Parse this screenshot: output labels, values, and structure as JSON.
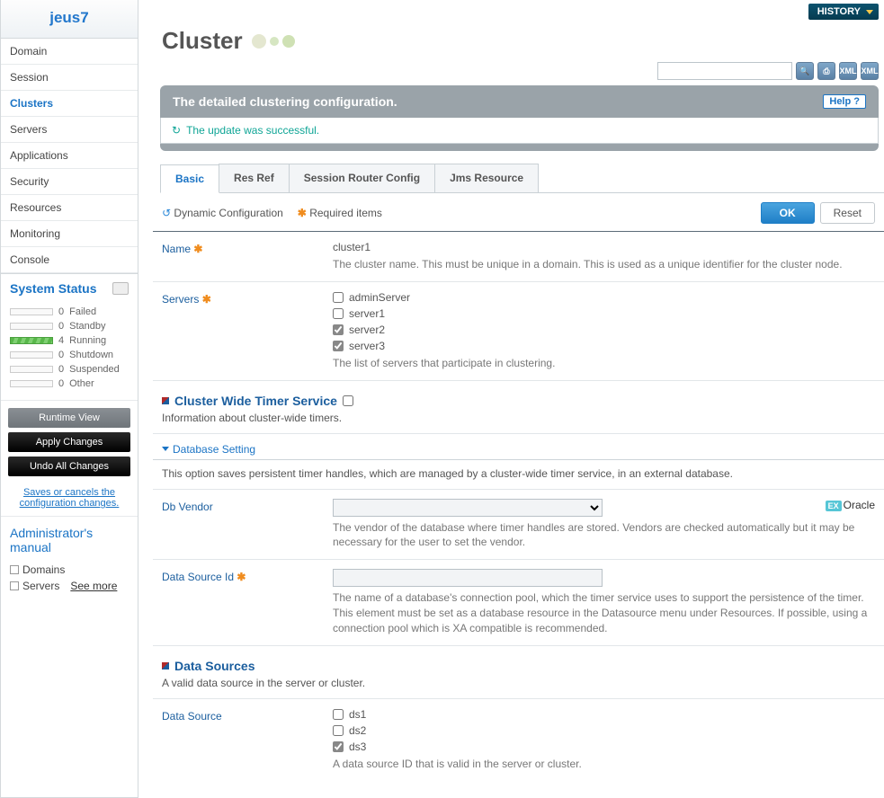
{
  "brand": "jeus7",
  "nav": [
    "Domain",
    "Session",
    "Clusters",
    "Servers",
    "Applications",
    "Security",
    "Resources",
    "Monitoring",
    "Console"
  ],
  "nav_active": 2,
  "system_status": {
    "title": "System Status",
    "rows": [
      {
        "count": "0",
        "label": "Failed",
        "filled": false
      },
      {
        "count": "0",
        "label": "Standby",
        "filled": false
      },
      {
        "count": "4",
        "label": "Running",
        "filled": true
      },
      {
        "count": "0",
        "label": "Shutdown",
        "filled": false
      },
      {
        "count": "0",
        "label": "Suspended",
        "filled": false
      },
      {
        "count": "0",
        "label": "Other",
        "filled": false
      }
    ]
  },
  "buttons": {
    "runtime": "Runtime View",
    "apply": "Apply Changes",
    "undo": "Undo All Changes"
  },
  "save_note": "Saves or cancels the configuration changes.",
  "manual": {
    "title": "Administrator's manual",
    "items": [
      "Domains",
      "Servers"
    ],
    "seemore": "See more"
  },
  "history": "HISTORY",
  "page_title": "Cluster",
  "panel": {
    "title": "The detailed clustering configuration.",
    "help": "Help  ?",
    "msg": "The update was successful."
  },
  "tabs": [
    "Basic",
    "Res Ref",
    "Session Router Config",
    "Jms Resource"
  ],
  "tab_active": 0,
  "legend": {
    "dynamic": "Dynamic Configuration",
    "required": "Required items"
  },
  "actions": {
    "ok": "OK",
    "reset": "Reset"
  },
  "fields": {
    "name": {
      "label": "Name",
      "value": "cluster1",
      "desc": "The cluster name. This must be unique in a domain. This is used as a unique identifier for the cluster node."
    },
    "servers": {
      "label": "Servers",
      "options": [
        {
          "label": "adminServer",
          "checked": false
        },
        {
          "label": "server1",
          "checked": false
        },
        {
          "label": "server2",
          "checked": true
        },
        {
          "label": "server3",
          "checked": true
        }
      ],
      "desc": "The list of servers that participate in clustering."
    }
  },
  "cluster_timer": {
    "title": "Cluster Wide Timer Service",
    "desc": "Information about cluster-wide timers."
  },
  "db_setting": {
    "toggle": "Database Setting",
    "desc": "This option saves persistent timer handles, which are managed by a cluster-wide timer service, in an external database."
  },
  "db_vendor": {
    "label": "Db Vendor",
    "ex_label": "Oracle",
    "desc": "The vendor of the database where timer handles are stored. Vendors are checked automatically but it may be necessary for the user to set the vendor."
  },
  "ds_id": {
    "label": "Data Source Id",
    "desc": "The name of a database's connection pool, which the timer service uses to support the persistence of the timer. This element must be set as a database resource in the Datasource menu under Resources. If possible, using a connection pool which is XA compatible is recommended."
  },
  "data_sources": {
    "title": "Data Sources",
    "desc": "A valid data source in the server or cluster."
  },
  "ds_field": {
    "label": "Data Source",
    "options": [
      {
        "label": "ds1",
        "checked": false
      },
      {
        "label": "ds2",
        "checked": false
      },
      {
        "label": "ds3",
        "checked": true
      }
    ],
    "desc": "A data source ID that is valid in the server or cluster."
  },
  "ex_tag": "EX"
}
